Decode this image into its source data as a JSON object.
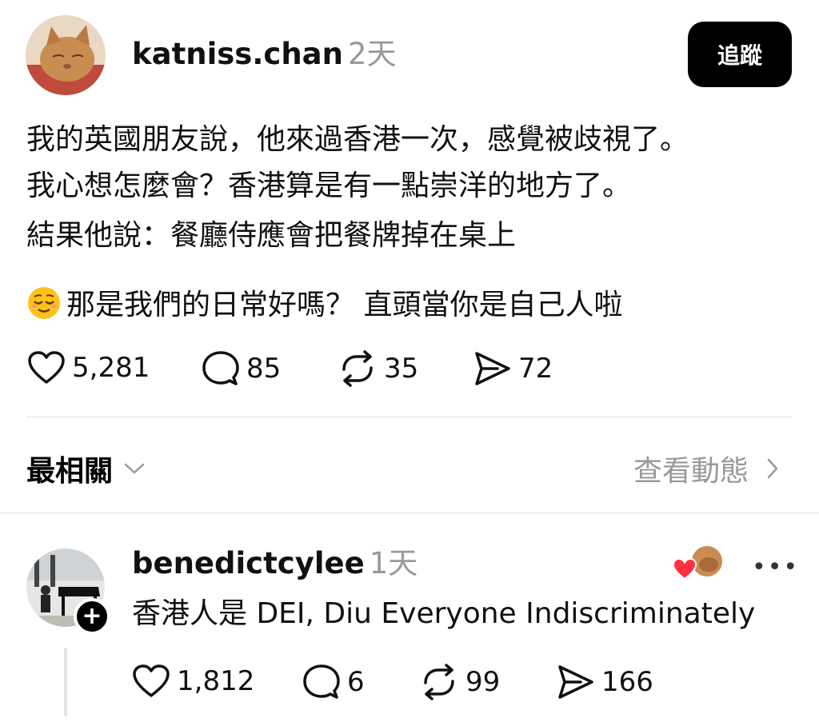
{
  "post": {
    "username": "katniss.chan",
    "time": "2天",
    "follow_label": "追蹤",
    "lines": [
      "我的英國朋友說，他來過香港一次，感覺被歧視了。",
      "我心想怎麼會？香港算是有一點崇洋的地方了。",
      "結果他說：餐廳侍應會把餐牌掉在桌上"
    ],
    "last_line": "那是我們的日常好嗎？ 直頭當你是自己人啦",
    "emoji": "relieved-face",
    "actions": {
      "likes": "5,281",
      "comments": "85",
      "reposts": "35",
      "shares": "72"
    }
  },
  "sort": {
    "label": "最相關",
    "activity_label": "查看動態"
  },
  "reply": {
    "username": "benedictcylee",
    "time": "1天",
    "text": "香港人是 DEI, Diu Everyone Indiscriminately",
    "actions": {
      "likes": "1,812",
      "comments": "6",
      "reposts": "99",
      "shares": "166"
    }
  },
  "colors": {
    "text": "#111111",
    "muted": "#999999",
    "divider": "#dddddd",
    "follow_bg": "#000000",
    "heart_red": "#ff3040"
  },
  "icons": [
    "heart-icon",
    "comment-icon",
    "repost-icon",
    "share-icon",
    "chevron-down-icon",
    "chevron-right-icon",
    "plus-icon",
    "more-icon"
  ]
}
